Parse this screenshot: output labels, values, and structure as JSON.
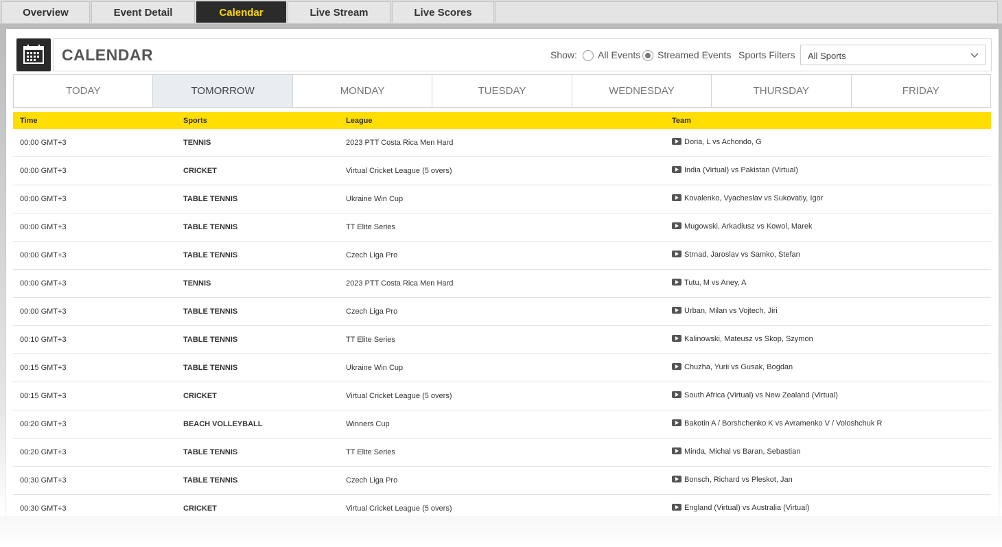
{
  "topnav": {
    "tabs": [
      {
        "label": "Overview"
      },
      {
        "label": "Event Detail"
      },
      {
        "label": "Calendar"
      },
      {
        "label": "Live Stream"
      },
      {
        "label": "Live Scores"
      }
    ],
    "active_index": 2
  },
  "calendar": {
    "title": "CALENDAR",
    "show_label": "Show:",
    "radio_all_events": "All Events",
    "radio_streamed_events": "Streamed Events",
    "selected_radio": "Streamed Events",
    "sports_filters_label": "Sports Filters",
    "sports_select_value": "All Sports"
  },
  "days": {
    "tabs": [
      "TODAY",
      "TOMORROW",
      "MONDAY",
      "TUESDAY",
      "WEDNESDAY",
      "THURSDAY",
      "FRIDAY"
    ],
    "active": "TOMORROW"
  },
  "table": {
    "headers": {
      "time": "Time",
      "sports": "Sports",
      "league": "League",
      "team": "Team"
    },
    "rows": [
      {
        "time": "00:00 GMT+3",
        "sport": "TENNIS",
        "league": "2023 PTT Costa Rica Men Hard",
        "team": "Doria, L vs Achondo, G"
      },
      {
        "time": "00:00 GMT+3",
        "sport": "CRICKET",
        "league": "Virtual Cricket League (5 overs)",
        "team": "India (Virtual) vs Pakistan (Virtual)"
      },
      {
        "time": "00:00 GMT+3",
        "sport": "TABLE TENNIS",
        "league": "Ukraine Win Cup",
        "team": "Kovalenko, Vyacheslav vs Sukovatiy, Igor"
      },
      {
        "time": "00:00 GMT+3",
        "sport": "TABLE TENNIS",
        "league": "TT Elite Series",
        "team": "Mugowski, Arkadiusz vs Kowol, Marek"
      },
      {
        "time": "00:00 GMT+3",
        "sport": "TABLE TENNIS",
        "league": "Czech Liga Pro",
        "team": "Strnad, Jaroslav vs Samko, Stefan"
      },
      {
        "time": "00:00 GMT+3",
        "sport": "TENNIS",
        "league": "2023 PTT Costa Rica Men Hard",
        "team": "Tutu, M vs Aney, A"
      },
      {
        "time": "00:00 GMT+3",
        "sport": "TABLE TENNIS",
        "league": "Czech Liga Pro",
        "team": "Urban, Milan vs Vojtech, Jiri"
      },
      {
        "time": "00:10 GMT+3",
        "sport": "TABLE TENNIS",
        "league": "TT Elite Series",
        "team": "Kalinowski, Mateusz vs Skop, Szymon"
      },
      {
        "time": "00:15 GMT+3",
        "sport": "TABLE TENNIS",
        "league": "Ukraine Win Cup",
        "team": "Chuzha, Yurii vs Gusak, Bogdan"
      },
      {
        "time": "00:15 GMT+3",
        "sport": "CRICKET",
        "league": "Virtual Cricket League (5 overs)",
        "team": "South Africa (Virtual) vs New Zealand (Virtual)"
      },
      {
        "time": "00:20 GMT+3",
        "sport": "BEACH VOLLEYBALL",
        "league": "Winners Cup",
        "team": "Bakotin A / Borshchenko K vs Avramenko V / Voloshchuk R"
      },
      {
        "time": "00:20 GMT+3",
        "sport": "TABLE TENNIS",
        "league": "TT Elite Series",
        "team": "Minda, Michal vs Baran, Sebastian"
      },
      {
        "time": "00:30 GMT+3",
        "sport": "TABLE TENNIS",
        "league": "Czech Liga Pro",
        "team": "Bonsch, Richard vs Pleskot, Jan"
      },
      {
        "time": "00:30 GMT+3",
        "sport": "CRICKET",
        "league": "Virtual Cricket League (5 overs)",
        "team": "England (Virtual) vs Australia (Virtual)"
      }
    ]
  },
  "icons": {
    "calendar": "calendar-icon",
    "stream": "play-icon",
    "dropdown": "chevron-down-icon"
  },
  "colors": {
    "accent_yellow": "#ffde00",
    "dark": "#2b2b2b",
    "active_day_bg": "#e8edf2"
  }
}
